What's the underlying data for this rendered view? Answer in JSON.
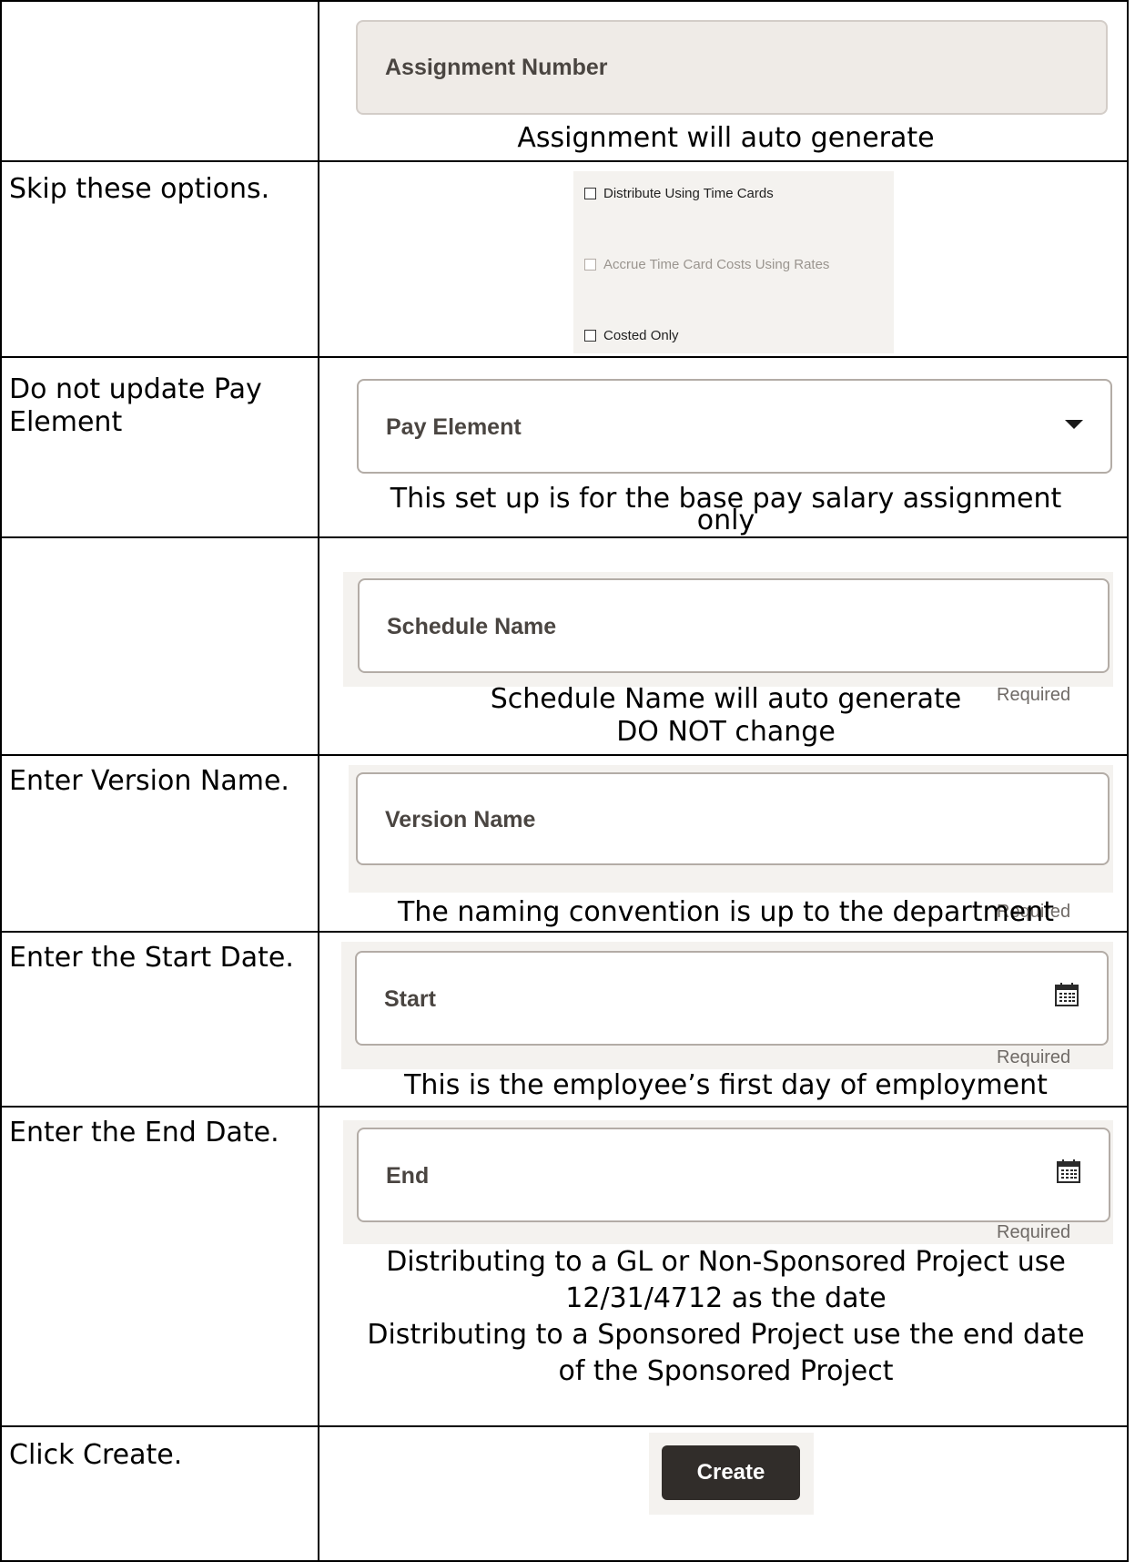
{
  "rows": [
    {
      "instruction": "",
      "field_label": "Assignment Number",
      "caption": [
        "Assignment will auto generate"
      ]
    },
    {
      "instruction": "Skip these options.",
      "checkboxes": [
        "Distribute Using Time Cards",
        "Accrue Time Card Costs Using Rates",
        "Costed Only"
      ]
    },
    {
      "instruction": "Do not update Pay Element",
      "field_label": "Pay Element",
      "caption": [
        "This set up is for the base pay salary assignment",
        "only"
      ]
    },
    {
      "instruction": "",
      "field_label": "Schedule Name",
      "required": "Required",
      "caption": [
        "Schedule Name will auto generate",
        "DO NOT change"
      ]
    },
    {
      "instruction": "Enter Version Name.",
      "field_label": "Version Name",
      "required": "Required",
      "caption": [
        "The naming convention is up to the department"
      ]
    },
    {
      "instruction": "Enter the Start Date.",
      "field_label": "Start",
      "required": "Required",
      "caption": [
        "This is the employee’s first day of employment"
      ]
    },
    {
      "instruction": "Enter the End Date.",
      "field_label": "End",
      "required": "Required",
      "caption": [
        "Distributing to a GL or Non-Sponsored Project use",
        "12/31/4712 as the date",
        "Distributing to a Sponsored Project use the end date",
        "of the Sponsored Project"
      ]
    },
    {
      "instruction": "Click Create.",
      "button_label": "Create"
    }
  ],
  "icons": {
    "dropdown": "chevron-down-icon",
    "calendar": "calendar-icon"
  }
}
